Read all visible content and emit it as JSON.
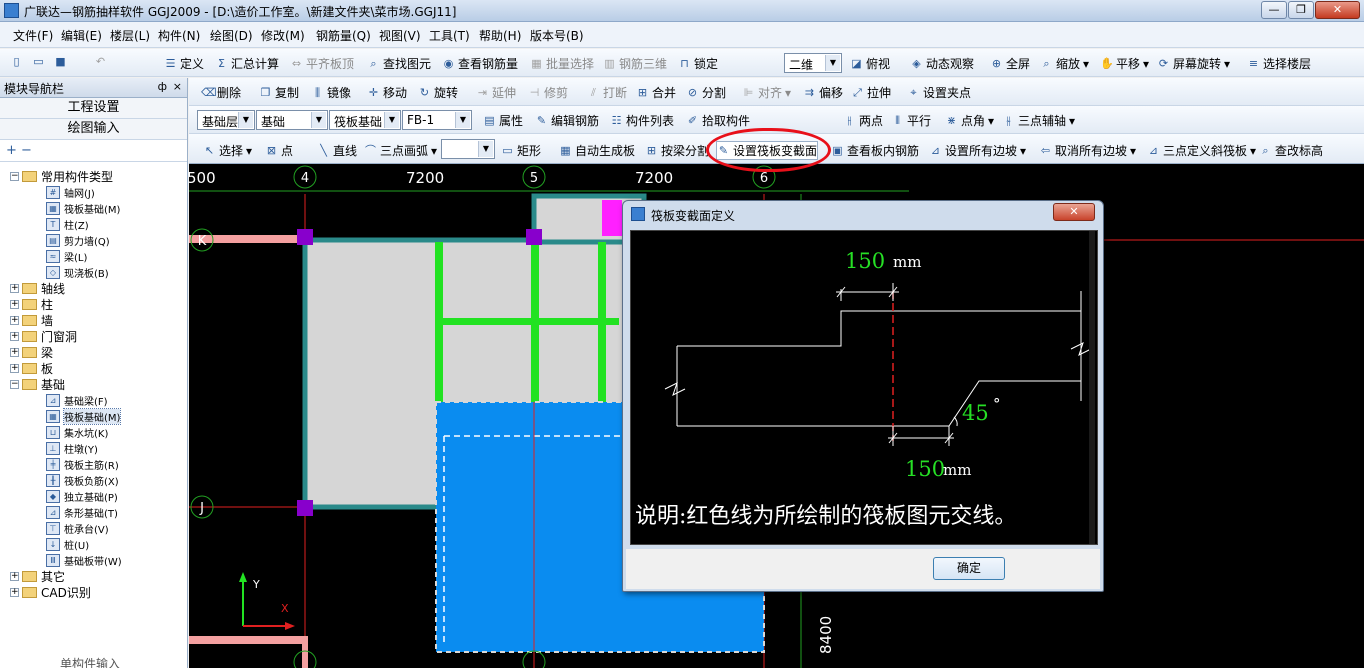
{
  "window": {
    "title": "广联达—钢筋抽样软件 GGJ2009 - [D:\\造价工作室。\\新建文件夹\\菜市场.GGJ11]",
    "minimize": "—",
    "maximize": "❐",
    "close": "✕"
  },
  "menu": [
    "文件(F)",
    "编辑(E)",
    "楼层(L)",
    "构件(N)",
    "绘图(D)",
    "修改(M)",
    "钢筋量(Q)",
    "视图(V)",
    "工具(T)",
    "帮助(H)",
    "版本号(B)"
  ],
  "toolbar1": {
    "define": "定义",
    "summary": "汇总计算",
    "align_slab": "平齐板顶",
    "find": "查找图元",
    "view_rebar": "查看钢筋量",
    "batch_select": "批量选择",
    "rebar_3d": "钢筋三维",
    "lock": "锁定",
    "view_mode": "二维",
    "top_view": "俯视",
    "dynamic": "动态观察",
    "fullscreen": "全屏",
    "zoom": "缩放",
    "pan": "平移",
    "rotate": "屏幕旋转",
    "select_floor": "选择楼层"
  },
  "nav": {
    "title": "模块导航栏",
    "pin": "ф",
    "close": "×",
    "project_settings": "工程设置",
    "drawing_input": "绘图输入",
    "tools": "+ −"
  },
  "tree": {
    "common_types": "常用构件类型",
    "axis_grid": "轴网(J)",
    "raft_foundation": "筏板基础(M)",
    "column": "柱(Z)",
    "shear_wall": "剪力墙(Q)",
    "beam": "梁(L)",
    "cast_slab": "现浇板(B)",
    "axis": "轴线",
    "col": "柱",
    "wall": "墙",
    "door_window": "门窗洞",
    "beam2": "梁",
    "slab": "板",
    "foundation": "基础",
    "foundation_beam": "基础梁(F)",
    "raft_foundation2": "筏板基础(M)",
    "sump": "集水坑(K)",
    "column_pier": "柱墩(Y)",
    "raft_main_rebar": "筏板主筋(R)",
    "raft_neg_rebar": "筏板负筋(X)",
    "isolated_foundation": "独立基础(P)",
    "strip_foundation": "条形基础(T)",
    "pile_cap": "桩承台(V)",
    "pile": "桩(U)",
    "foundation_strip": "基础板带(W)",
    "other": "其它",
    "cad": "CAD识别",
    "bottom_hint": "单构件输入"
  },
  "toolbar2": {
    "delete": "删除",
    "copy": "复制",
    "mirror": "镜像",
    "move": "移动",
    "rotate": "旋转",
    "extend": "延伸",
    "trim": "修剪",
    "break": "打断",
    "merge": "合并",
    "split": "分割",
    "align": "对齐",
    "offset": "偏移",
    "stretch": "拉伸",
    "set_grip": "设置夹点"
  },
  "toolbar3": {
    "floor": "基础层",
    "category": "基础",
    "type": "筏板基础",
    "item": "FB-1",
    "props": "属性",
    "edit_rebar": "编辑钢筋",
    "member_list": "构件列表",
    "pick_member": "拾取构件",
    "two_points": "两点",
    "parallel": "平行",
    "point_angle": "点角",
    "three_point_axis": "三点辅轴"
  },
  "toolbar4": {
    "select": "选择",
    "point": "点",
    "line": "直线",
    "arc": "三点画弧",
    "rect": "矩形",
    "auto_gen": "自动生成板",
    "split_by_beam": "按梁分割",
    "set_section": "设置筏板变截面",
    "view_inner_rebar": "查看板内钢筋",
    "set_all_edges": "设置所有边坡",
    "cancel_all_edges": "取消所有边坡",
    "three_point_slope": "三点定义斜筏板",
    "change_elev": "查改标高"
  },
  "canvas": {
    "axis_top": [
      "4",
      "5",
      "6"
    ],
    "axis_side": [
      "K",
      "J"
    ],
    "dims_top": [
      "500",
      "7200",
      "7200"
    ],
    "dim_side": "8400",
    "ucs_x": "X",
    "ucs_y": "Y"
  },
  "dialog": {
    "title": "筏板变截面定义",
    "close": "✕",
    "dim_top_value": "150",
    "dim_top_unit": "mm",
    "dim_bottom_value": "150",
    "dim_bottom_unit": "mm",
    "angle_value": "45",
    "angle_unit": "°",
    "note": "说明:红色线为所绘制的筏板图元交线。",
    "ok": "确定"
  },
  "colors": {
    "canvas_bg": "#000000",
    "slab_fill": "#d6d6d6",
    "slab_border": "#2a8a8a",
    "beam_green": "#22e222",
    "raft_blue": "#0a8cf0",
    "node_purple": "#8800cc",
    "grid_red": "#e02020",
    "annotation_circle": "#e8101a"
  }
}
